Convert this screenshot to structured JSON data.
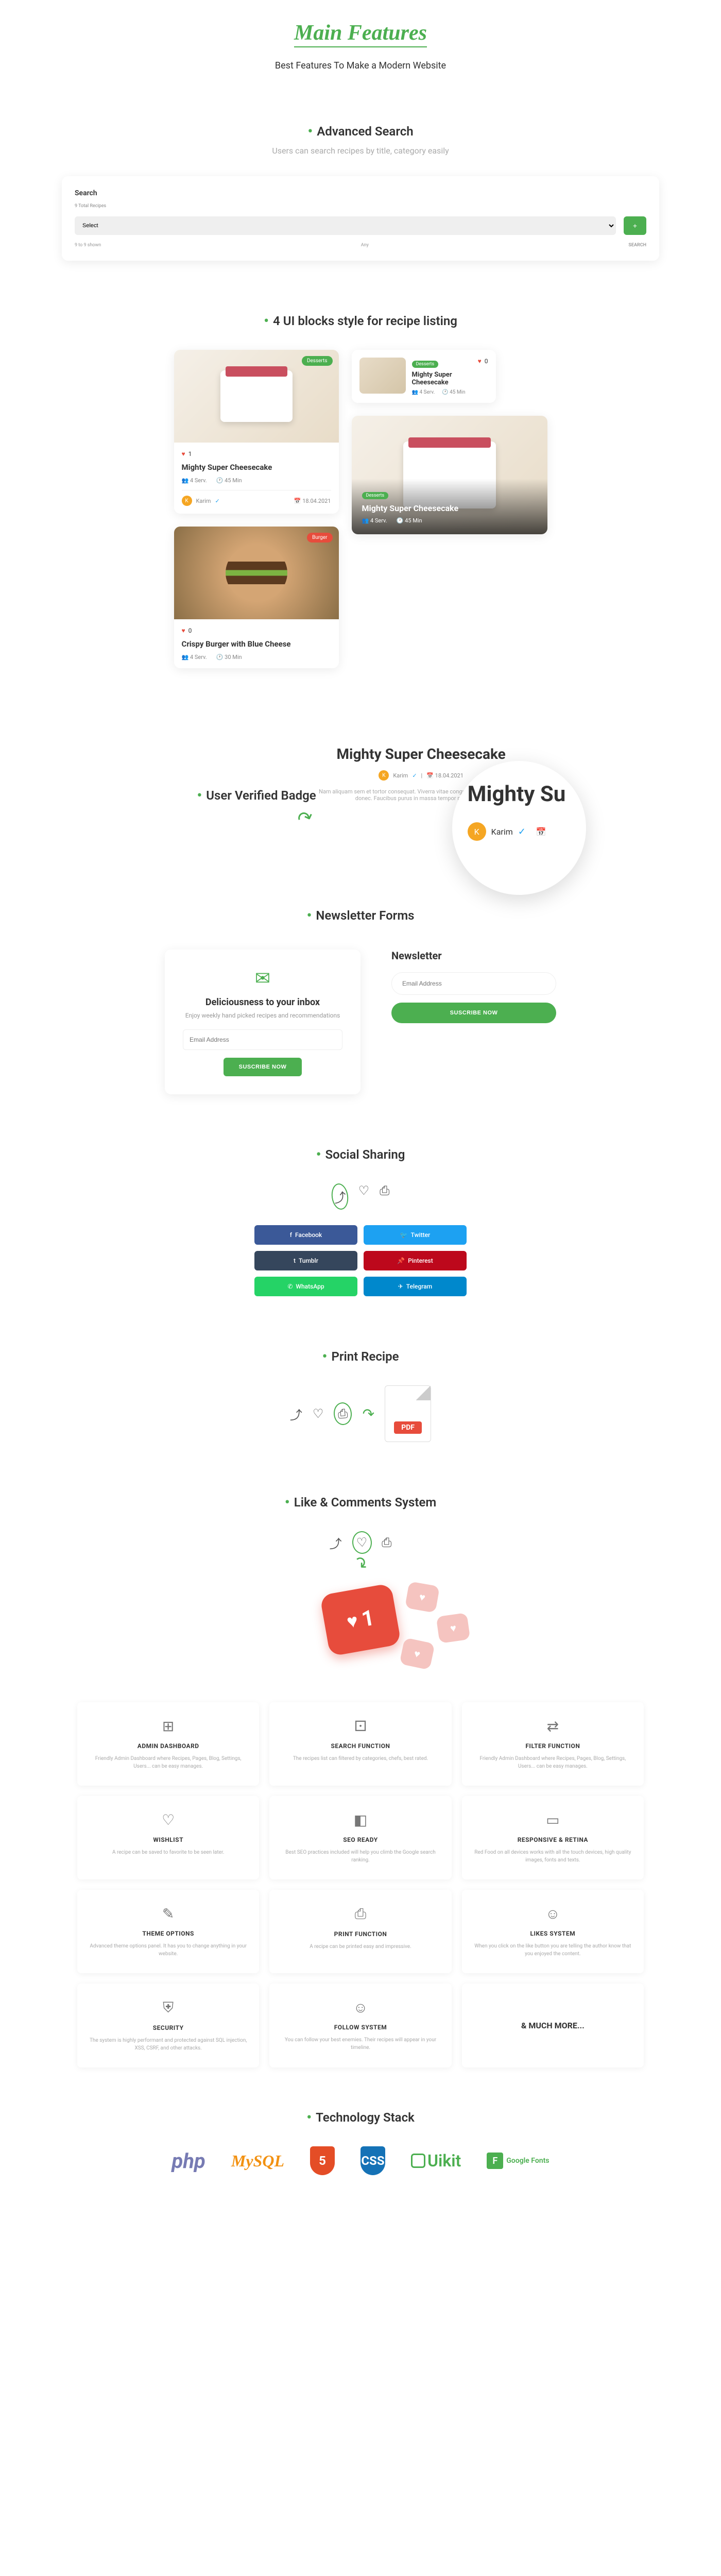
{
  "header": {
    "main_title": "Main Features",
    "subtitle": "Best Features To Make a Modern Website"
  },
  "advanced_search": {
    "title": "Advanced Search",
    "desc": "Users can search recipes by title, category easily",
    "label": "Search",
    "meta": "9 Total Recipes",
    "select_placeholder": "Select",
    "plus": "+",
    "all_text": "9 to 9 shown",
    "all_option": "Any",
    "search_btn": "SEARCH"
  },
  "ui_blocks": {
    "title": "4 UI blocks style for recipe listing",
    "card1": {
      "tag": "Desserts",
      "likes": "1",
      "title": "Mighty Super Cheesecake",
      "servings": "4 Serv.",
      "time": "45 Min",
      "author": "Karim",
      "date": "18.04.2021"
    },
    "card2": {
      "tag": "Desserts",
      "likes": "0",
      "title": "Mighty Super Cheesecake",
      "servings": "4 Serv.",
      "time": "45 Min"
    },
    "card3": {
      "tag": "Burger",
      "likes": "0",
      "title": "Crispy Burger with Blue Cheese",
      "servings": "4 Serv.",
      "time": "30 Min"
    },
    "card4": {
      "tag": "Desserts",
      "title": "Mighty Super Cheesecake",
      "servings": "4 Serv.",
      "time": "45 Min"
    }
  },
  "verified": {
    "title": "User Verified Badge",
    "recipe_title": "Mighty Super Cheesecake",
    "author": "Karim",
    "date": "18.04.2021",
    "desc": "Nam aliquam sem et tortor consequat. Viverra vitae congue eu consequat ac felis donec. Faucibus purus in massa tempor nec feugiat.",
    "zoom_text": "Mighty Su",
    "zoom_author": "Karim"
  },
  "newsletter": {
    "section_title": "Newsletter Forms",
    "card1": {
      "title": "Deliciousness to your inbox",
      "desc": "Enjoy weekly hand picked recipes and recommendations",
      "placeholder": "Email Address",
      "btn": "SUSCRIBE NOW"
    },
    "card2": {
      "title": "Newsletter",
      "placeholder": "Email Address",
      "btn": "SUSCRIBE NOW"
    }
  },
  "social": {
    "title": "Social Sharing",
    "buttons": {
      "fb": "Facebook",
      "tw": "Twitter",
      "tm": "Tumblr",
      "pn": "Pinterest",
      "wa": "WhatsApp",
      "tg": "Telegram"
    }
  },
  "print": {
    "title": "Print Recipe",
    "pdf": "PDF"
  },
  "likes": {
    "title": "Like & Comments System",
    "count": "1"
  },
  "features": [
    {
      "icon": "⊞",
      "title": "ADMIN DASHBOARD",
      "desc": "Friendly Admin Dashboard where Recipes, Pages, Blog, Settings, Users... can be easy manages."
    },
    {
      "icon": "⚀",
      "title": "SEARCH FUNCTION",
      "desc": "The recipes list can filtered by categories, chefs, best rated."
    },
    {
      "icon": "⇄",
      "title": "FILTER FUNCTION",
      "desc": "Friendly Admin Dashboard where Recipes, Pages, Blog, Settings, Users... can be easy manages."
    },
    {
      "icon": "♡",
      "title": "WISHLIST",
      "desc": "A recipe can be saved to favorite to be seen later."
    },
    {
      "icon": "◧",
      "title": "SEO READY",
      "desc": "Best SEO practices included will help you climb the Google search ranking."
    },
    {
      "icon": "▭",
      "title": "RESPONSIVE & RETINA",
      "desc": "Red Food on all devices works with all the touch devices, high quality images, fonts and texts."
    },
    {
      "icon": "✎",
      "title": "THEME OPTIONS",
      "desc": "Advanced theme options panel. It has you to change anything in your website."
    },
    {
      "icon": "⎙",
      "title": "PRINT FUNCTION",
      "desc": "A recipe can be printed easy and impressive."
    },
    {
      "icon": "☺",
      "title": "LIKES SYSTEM",
      "desc": "When you click on the like button you are telling the author know that you enjoyed the content."
    },
    {
      "icon": "⛨",
      "title": "SECURITY",
      "desc": "The system is highly performant and protected against SQL injection, XSS, CSRF, and other attacks."
    },
    {
      "icon": "☺",
      "title": "FOLLOW SYSTEM",
      "desc": "You can follow your best enemies. Their recipes will appear in your timeline."
    }
  ],
  "much_more": "& MUCH MORE...",
  "tech": {
    "title": "Technology Stack",
    "items": {
      "php": "php",
      "mysql": "MySQL",
      "html5": "5",
      "css3": "CSS",
      "uikit": "Uikit",
      "gfonts": "Google Fonts"
    }
  }
}
